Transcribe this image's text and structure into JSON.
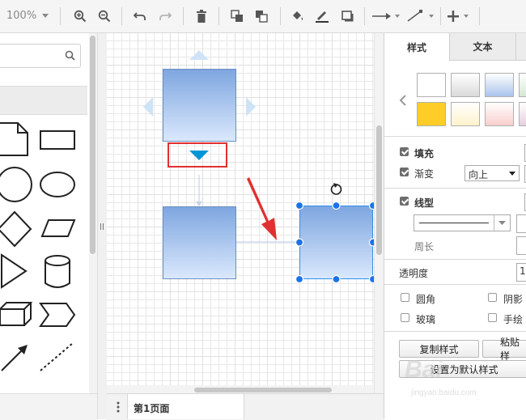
{
  "toolbar": {
    "zoom": "100%"
  },
  "right_panel": {
    "tabs": [
      "样式",
      "文本"
    ],
    "swatches_row1": [
      "#ffffff",
      "#dadada",
      "#a9c4eb",
      "#d5e8d4"
    ],
    "swatches_row2": [
      "#ffcd28",
      "#fff2cc",
      "#f8cecc",
      "#e6d0de"
    ],
    "fill": {
      "label": "填充",
      "checked": true
    },
    "gradient": {
      "label": "渐变",
      "checked": true,
      "direction": "向上"
    },
    "line": {
      "label": "线型",
      "checked": true
    },
    "perimeter": {
      "label": "周长"
    },
    "opacity": {
      "label": "透明度",
      "value": "1"
    },
    "rounded": {
      "label": "圆角",
      "checked": false
    },
    "shadow": {
      "label": "阴影",
      "checked": false
    },
    "glass": {
      "label": "玻璃",
      "checked": false
    },
    "sketch": {
      "label": "手绘",
      "checked": false
    },
    "copy_style": "复制样式",
    "paste_style": "粘贴样",
    "set_default": "设置为默认样式"
  },
  "page_tab": {
    "label": "第1页面"
  },
  "watermark": {
    "brand": "Bai",
    "sub": "jingyan.baidu.com"
  },
  "colors": {
    "accent": "#1a73e8",
    "shape_fill_top": "#7ea6e0",
    "shape_fill_bottom": "#dae8fc",
    "shape_stroke": "#6c8ebf",
    "highlight_red": "#e03030",
    "arrow_cyan": "#0096d6"
  }
}
